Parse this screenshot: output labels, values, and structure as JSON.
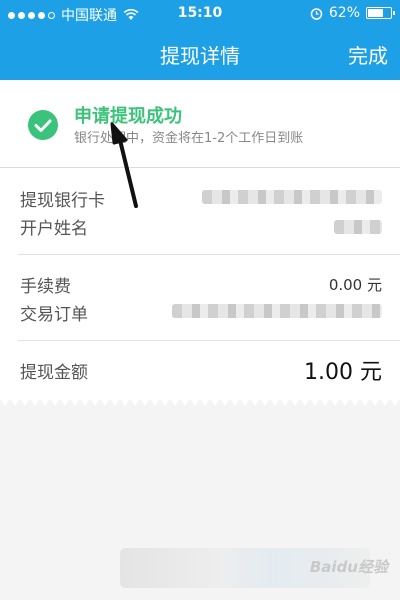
{
  "status_bar": {
    "carrier": "中国联通",
    "time": "15:10",
    "battery": "62%",
    "battery_level": 0.62
  },
  "nav": {
    "title": "提现详情",
    "done_label": "完成"
  },
  "success": {
    "title": "申请提现成功",
    "subtitle": "银行处理中，资金将在1-2个工作日到账"
  },
  "details": {
    "bank_card_label": "提现银行卡",
    "account_name_label": "开户姓名",
    "fee_label": "手续费",
    "fee_value": "0.00 元",
    "order_label": "交易订单",
    "amount_label": "提现金额",
    "amount_value": "1.00 元"
  },
  "watermark": "Baidu经验"
}
